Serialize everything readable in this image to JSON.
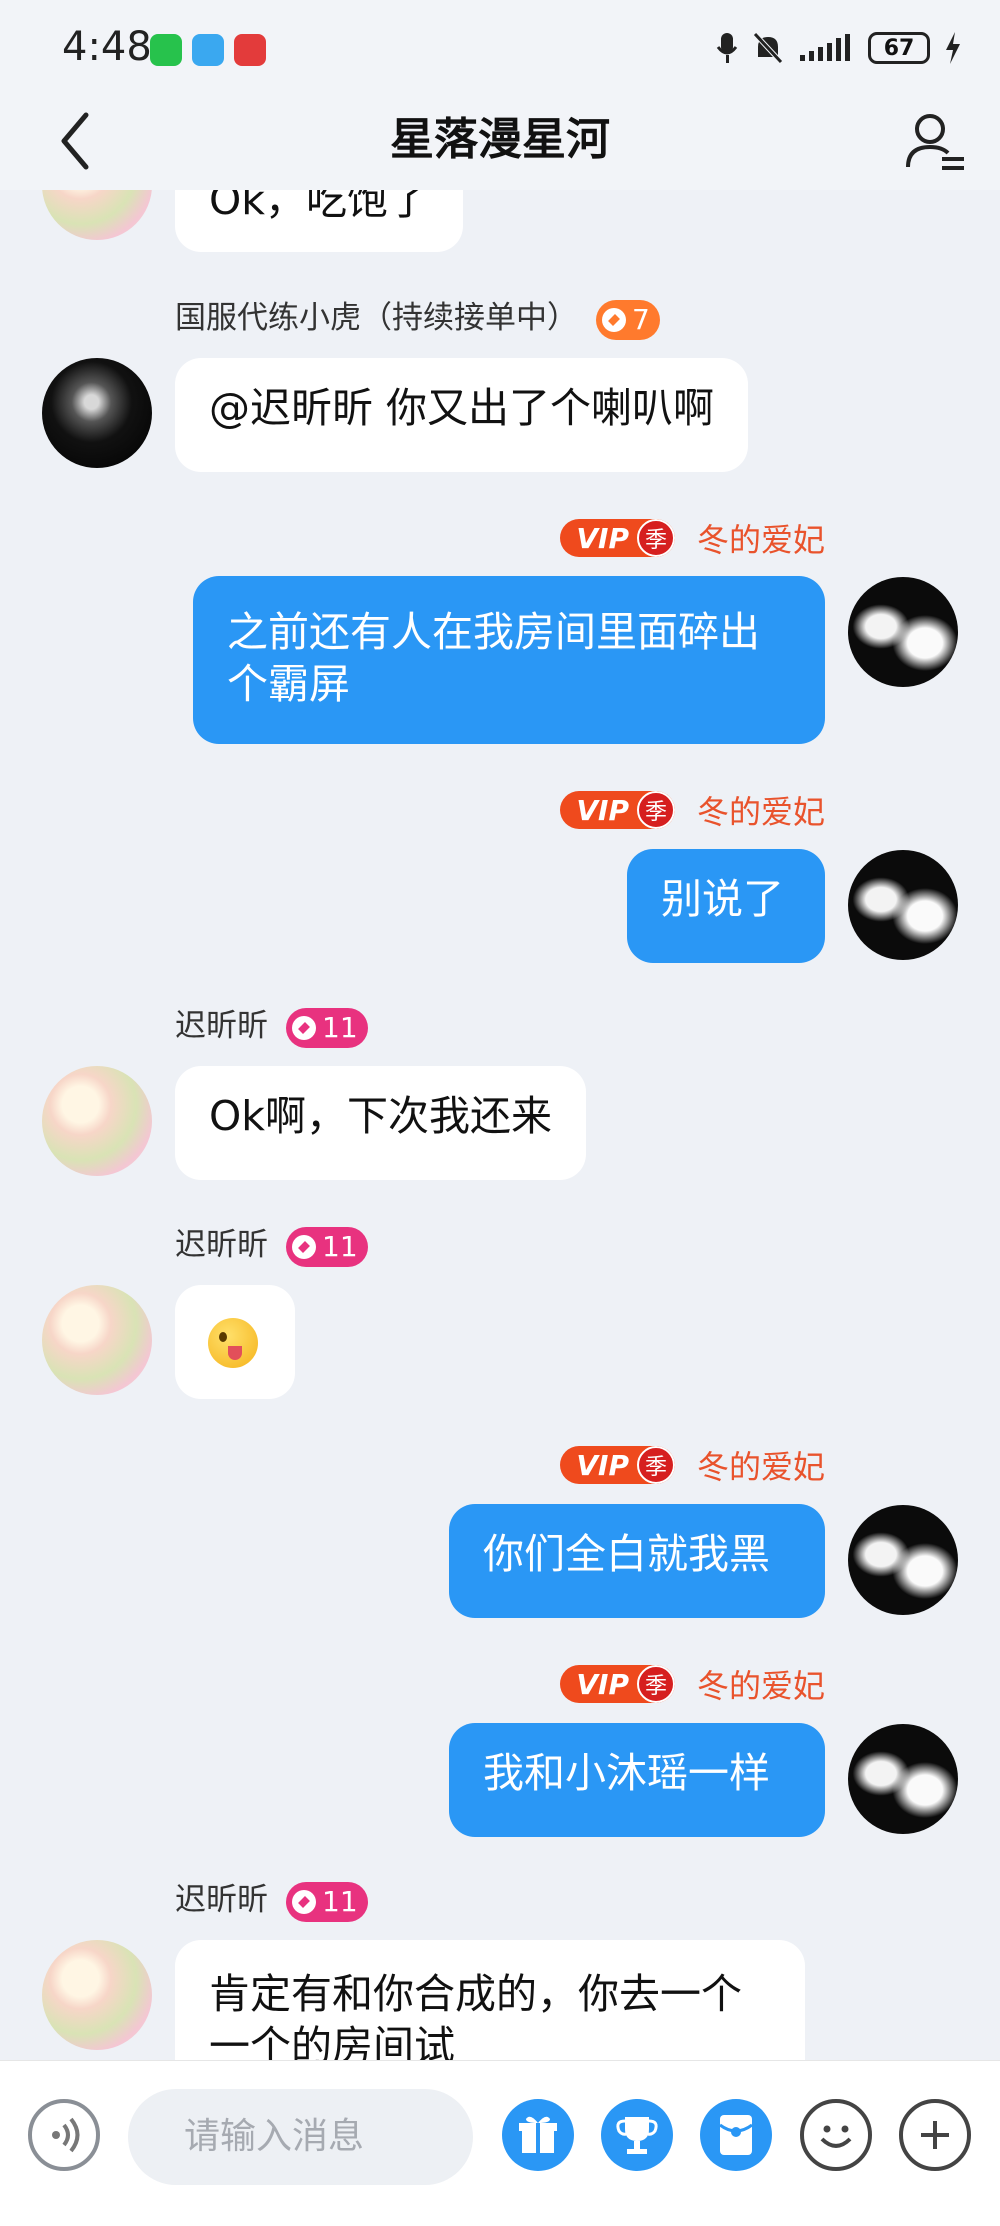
{
  "status_bar": {
    "time": "4:48",
    "battery": "67"
  },
  "header": {
    "title": "星落漫星河"
  },
  "messages": [
    {
      "side": "left",
      "text": "Ok，吃饱了"
    },
    {
      "side": "left",
      "sender": "国服代练小虎（持续接单中）",
      "level": "7",
      "level_color": "#ff7a2d",
      "text": "@迟昕昕 你又出了个喇叭啊"
    },
    {
      "side": "right",
      "vip": "VIP",
      "season": "季",
      "sender": "冬的爱妃",
      "text": "之前还有人在我房间里面碎出个霸屏"
    },
    {
      "side": "right",
      "vip": "VIP",
      "season": "季",
      "sender": "冬的爱妃",
      "text": "别说了"
    },
    {
      "side": "left",
      "sender": "迟昕昕",
      "level": "11",
      "level_color": "#e8327f",
      "text": "Ok啊，下次我还来"
    },
    {
      "side": "left",
      "sender": "迟昕昕",
      "level": "11",
      "level_color": "#e8327f",
      "emoji": "winking-tongue-emoji"
    },
    {
      "side": "right",
      "vip": "VIP",
      "season": "季",
      "sender": "冬的爱妃",
      "text": "你们全白就我黑"
    },
    {
      "side": "right",
      "vip": "VIP",
      "season": "季",
      "sender": "冬的爱妃",
      "text": "我和小沐瑶一样"
    },
    {
      "side": "left",
      "sender": "迟昕昕",
      "level": "11",
      "level_color": "#e8327f",
      "text": "肯定有和你合成的，你去一个一个的房间试"
    }
  ],
  "input": {
    "placeholder": "请输入消息"
  },
  "icons": {
    "voice": "voice-icon",
    "gift": "gift-icon",
    "trophy": "trophy-icon",
    "red_packet": "red-packet-icon",
    "emoji": "emoji-icon",
    "plus": "plus-icon"
  },
  "colors": {
    "accent": "#2a97f5",
    "sender_red": "#e9532c",
    "vip": "#ef4a1d"
  }
}
